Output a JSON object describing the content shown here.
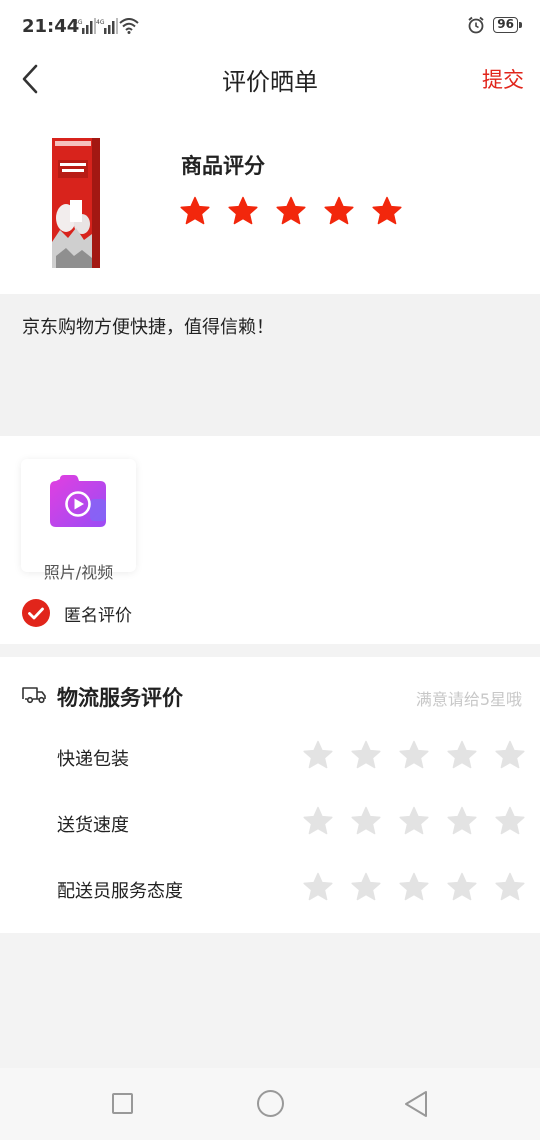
{
  "status_bar": {
    "time": "21:44",
    "signal1": "4G",
    "signal2": "4G",
    "battery": "96"
  },
  "nav": {
    "title": "评价晒单",
    "submit": "提交",
    "back_icon": "chevron-left-icon"
  },
  "product": {
    "rating_label": "商品评分",
    "rating": 5,
    "max_rating": 5,
    "star_color": "#f2270c"
  },
  "comment": {
    "text": "京东购物方便快捷，值得信赖！"
  },
  "upload": {
    "label": "照片/视频",
    "icon": "camera-icon"
  },
  "anonymous": {
    "label": "匿名评价",
    "checked": true,
    "color": "#e1251b"
  },
  "logistics": {
    "title": "物流服务评价",
    "hint": "满意请给5星哦",
    "icon": "truck-icon",
    "star_empty_color": "#e3e3e3",
    "rows": [
      {
        "label": "快递包装",
        "rating": 0
      },
      {
        "label": "送货速度",
        "rating": 0
      },
      {
        "label": "配送员服务态度",
        "rating": 0
      }
    ]
  },
  "system_nav": {
    "recent_icon": "square-icon",
    "home_icon": "circle-icon",
    "back_icon": "triangle-back-icon"
  }
}
